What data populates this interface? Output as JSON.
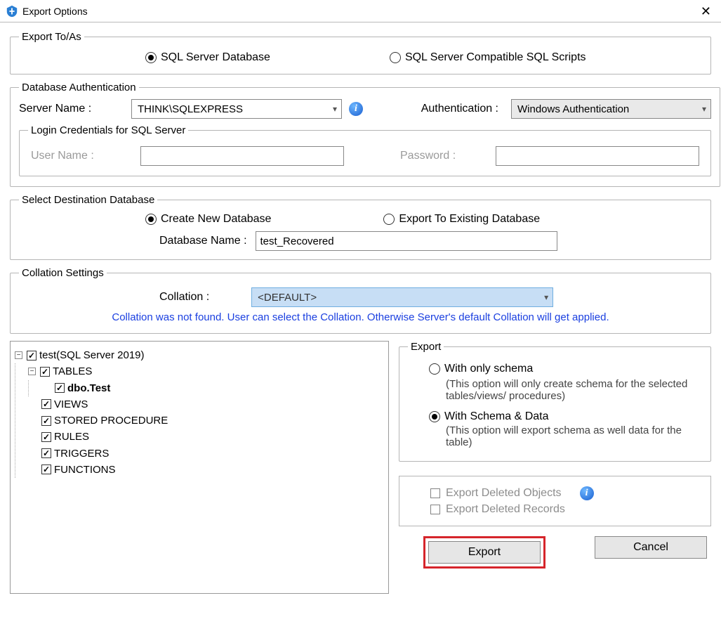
{
  "window": {
    "title": "Export Options"
  },
  "exportTo": {
    "legend": "Export To/As",
    "opt1": "SQL Server Database",
    "opt2": "SQL Server Compatible SQL Scripts",
    "selected": 1
  },
  "dbAuth": {
    "legend": "Database Authentication",
    "serverLabel": "Server Name :",
    "serverValue": "THINK\\SQLEXPRESS",
    "authLabel": "Authentication :",
    "authValue": "Windows Authentication",
    "loginLegend": "Login Credentials for SQL Server",
    "userLabel": "User Name :",
    "userValue": "",
    "passLabel": "Password :",
    "passValue": ""
  },
  "destDb": {
    "legend": "Select Destination Database",
    "opt1": "Create New Database",
    "opt2": "Export To Existing Database",
    "selected": 1,
    "nameLabel": "Database Name :",
    "nameValue": "test_Recovered"
  },
  "collation": {
    "legend": "Collation Settings",
    "label": "Collation :",
    "value": "<DEFAULT>",
    "note": "Collation was not found. User can select the Collation. Otherwise Server's default Collation will get applied."
  },
  "tree": {
    "root": "test(SQL Server 2019)",
    "tables": "TABLES",
    "table0": "dbo.Test",
    "views": "VIEWS",
    "sp": "STORED PROCEDURE",
    "rules": "RULES",
    "triggers": "TRIGGERS",
    "functions": "FUNCTIONS"
  },
  "exportOpts": {
    "legend": "Export",
    "schemaOnly": "With only schema",
    "schemaOnlyDesc": "(This option will only create schema for the  selected tables/views/ procedures)",
    "schemaData": "With Schema & Data",
    "schemaDataDesc": "(This option will export schema as well data for the table)",
    "selected": 2,
    "delObjects": "Export Deleted Objects",
    "delRecords": "Export Deleted Records"
  },
  "buttons": {
    "export": "Export",
    "cancel": "Cancel"
  }
}
